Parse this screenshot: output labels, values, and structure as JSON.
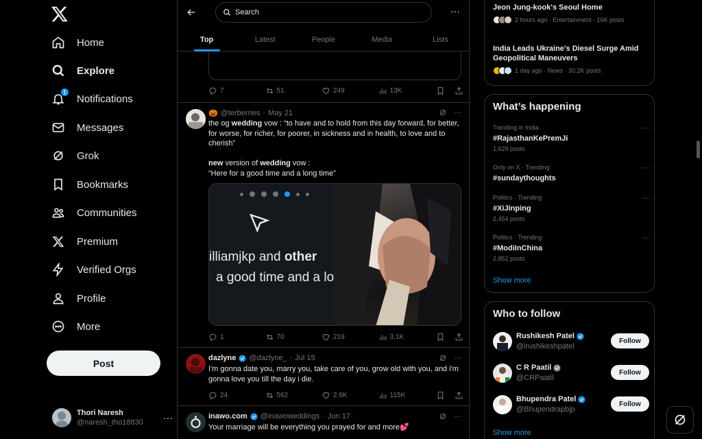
{
  "nav": {
    "items": [
      {
        "label": "Home",
        "icon": "home-icon"
      },
      {
        "label": "Explore",
        "icon": "search-icon"
      },
      {
        "label": "Notifications",
        "icon": "bell-icon",
        "badge": "1"
      },
      {
        "label": "Messages",
        "icon": "envelope-icon"
      },
      {
        "label": "Grok",
        "icon": "grok-icon"
      },
      {
        "label": "Bookmarks",
        "icon": "bookmark-icon"
      },
      {
        "label": "Communities",
        "icon": "communities-icon"
      },
      {
        "label": "Premium",
        "icon": "x-logo-icon"
      },
      {
        "label": "Verified Orgs",
        "icon": "lightning-icon"
      },
      {
        "label": "Profile",
        "icon": "person-icon"
      },
      {
        "label": "More",
        "icon": "more-circle-icon"
      }
    ],
    "post_label": "Post",
    "account": {
      "name": "Thori Naresh",
      "handle": "@naresh_tho18830",
      "more": "···"
    }
  },
  "main": {
    "search_placeholder": "Search",
    "more": "···",
    "tabs": [
      "Top",
      "Latest",
      "People",
      "Media",
      "Lists"
    ],
    "active_tab": "Top",
    "prev_tweet_actions": {
      "replies": "7",
      "reposts": "51",
      "likes": "249",
      "views": "13K"
    },
    "tweets": [
      {
        "emoji": "🎃",
        "handle": "@terberries",
        "date": "May 21",
        "body_line1_a": "the og ",
        "body_line1_b": "wedding",
        "body_line1_c": " vow : “to have and to hold from this day forward, for better,",
        "body_line2": "for worse, for richer, for poorer, in sickness and in health, to love and to",
        "body_line3": "cherish”",
        "body_line4_a": "new",
        "body_line4_b": " version of ",
        "body_line4_c": "wedding",
        "body_line4_d": " vow :",
        "body_line5": "“Here for a good time and a long time”",
        "media_text1_a": "illiamjkp and ",
        "media_text1_b": "other",
        "media_text2": "a good time and a lo",
        "actions": {
          "replies": "1",
          "reposts": "70",
          "likes": "219",
          "views": "3.1K"
        }
      },
      {
        "name": "dazlyne",
        "handle": "@dazlyne_",
        "date": "Jul 15",
        "body_line1": "I'm gonna date you, marry you, take care of you, grow old with you, and i'm",
        "body_line2": "gonna love you till the day i die.",
        "actions": {
          "replies": "24",
          "reposts": "562",
          "likes": "2.6K",
          "views": "115K"
        }
      },
      {
        "name": "inawo.com",
        "handle": "@inawoweddings",
        "date": "Jun 17",
        "body_line1": "Your marriage will be everything you prayed for and more💕"
      }
    ]
  },
  "right": {
    "news": [
      {
        "title_line1": "Jeon Jung-kook's Seoul Home",
        "meta": "2 hours ago · Entertainment · 16K posts"
      },
      {
        "title_line1": "India Leads Ukraine's Diesel Surge Amid",
        "title_line2": "Geopolitical Maneuvers",
        "meta": "1 day ago · News · 30.2K posts"
      }
    ],
    "happening_title": "What’s happening",
    "trends": [
      {
        "category": "Trending in India",
        "name": "#RajasthanKePremJi",
        "count": "1,629 posts"
      },
      {
        "category": "Only on X · Trending",
        "name": "#sundaythoughts",
        "count": ""
      },
      {
        "category": "Politics · Trending",
        "name": "#XiJinping",
        "count": "2,454 posts"
      },
      {
        "category": "Politics · Trending",
        "name": "#ModiInChina",
        "count": "2,852 posts"
      }
    ],
    "show_more": "Show more",
    "wtf_title": "Who to follow",
    "who_to_follow": [
      {
        "name": "Rushikesh Patel",
        "handle": "@irushikeshpatel",
        "verified": "blue"
      },
      {
        "name": "C R Paatil",
        "handle": "@CRPaatil",
        "verified": "gray"
      },
      {
        "name": "Bhupendra Patel",
        "handle": "@Bhupendrapbjp",
        "verified": "blue"
      }
    ],
    "follow_label": "Follow",
    "show_more_2": "Show more"
  },
  "colors": {
    "accent": "#1d9bf0",
    "background": "#000000",
    "text": "#e7e9ea",
    "muted": "#71767b",
    "border": "#2f3336"
  }
}
